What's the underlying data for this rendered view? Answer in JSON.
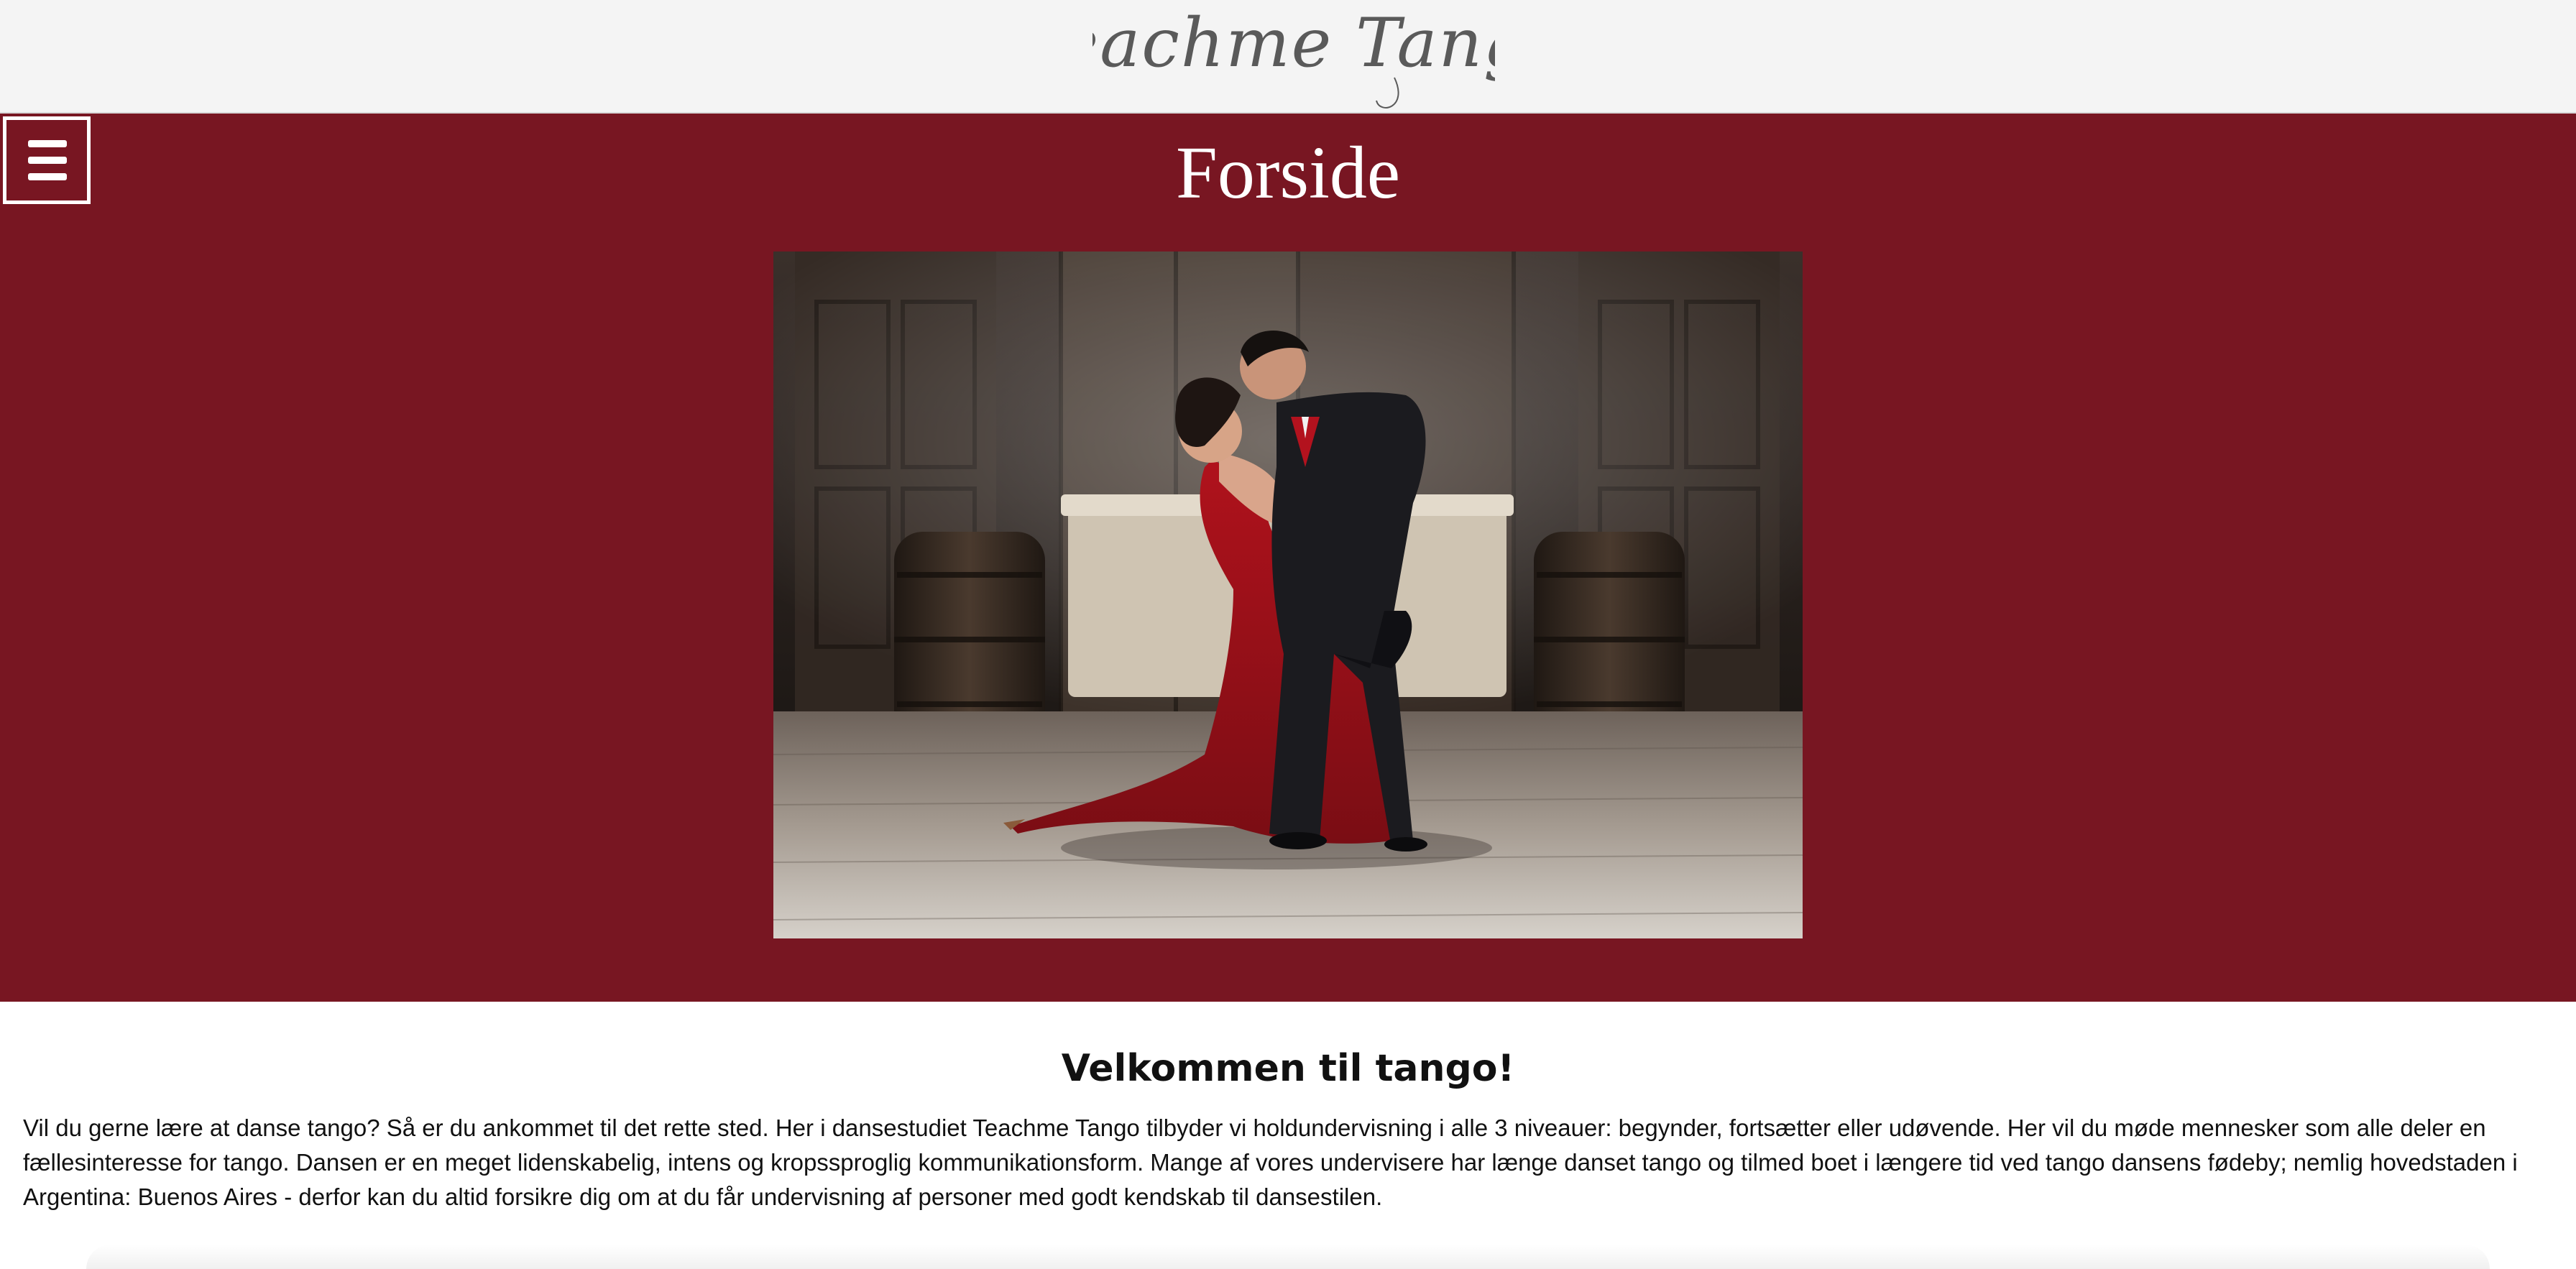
{
  "header": {
    "logo_text": "Teachme Tango"
  },
  "nav": {
    "menu_icon": "hamburger-menu-icon"
  },
  "hero": {
    "title": "Forside",
    "background_color": "#781622",
    "image_alt": "Tango dancing couple"
  },
  "main": {
    "heading": "Velkommen til tango!",
    "paragraph": "Vil du gerne lære at danse tango? Så er du ankommet til det rette sted. Her i dansestudiet Teachme Tango tilbyder vi holdundervisning i alle 3 niveauer: begynder, fortsætter eller udøvende. Her vil du møde mennesker som alle deler en fællesinteresse for tango. Dansen er en meget lidenskabelig, intens og kropssproglig kommunikationsform. Mange af vores undervisere har længe danset tango og tilmed boet i længere tid ved tango dansens fødeby; nemlig hovedstaden i Argentina: Buenos Aires - derfor kan du altid forsikre dig om at du får undervisning af personer med godt kendskab til dansestilen."
  }
}
